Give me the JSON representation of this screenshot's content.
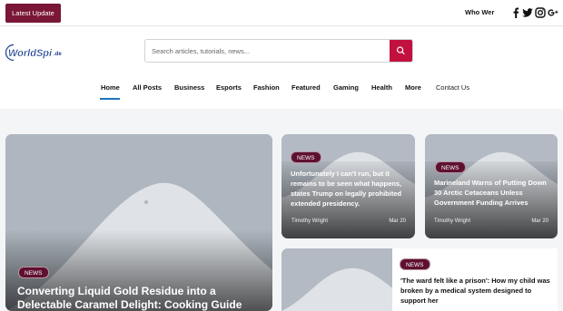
{
  "topbar": {
    "latest_label": "Latest Update",
    "ticker_text": "Who Wer",
    "social_icons": [
      "facebook-icon",
      "twitter-icon",
      "instagram-icon",
      "google-plus-icon"
    ]
  },
  "header": {
    "logo_text": "WorldSpi",
    "logo_tld": ".de",
    "search_placeholder": "Search articles, tutorials, news..."
  },
  "nav": {
    "items": [
      "Home",
      "All Posts",
      "Business",
      "Esports",
      "Fashion",
      "Featured",
      "Gaming",
      "Health",
      "More",
      "Contact Us"
    ],
    "active": "Home"
  },
  "colors": {
    "brand": "#7a1636",
    "accent": "#c2113f",
    "active_underline": "#1e73be"
  },
  "posts": {
    "hero": {
      "badge": "NEWS",
      "title": "Converting Liquid Gold Residue into a Delectable Caramel Delight: Cooking Guide"
    },
    "small1": {
      "badge": "NEWS",
      "title": "Unfortunately I can't run, but it remains to be seen what happens, states Trump on legally prohibited extended presidency.",
      "author": "Timothy Wright",
      "date": "Mar 20"
    },
    "small2": {
      "badge": "NEWS",
      "title": "Marineland Warns of Putting Down 30 Arctic Cetaceans Unless Government Funding Arrives",
      "author": "Timothy Wright",
      "date": "Mar 20"
    },
    "list1": {
      "badge": "NEWS",
      "title": "'The ward felt like a prison': How my child was broken by a medical system designed to support her"
    }
  }
}
